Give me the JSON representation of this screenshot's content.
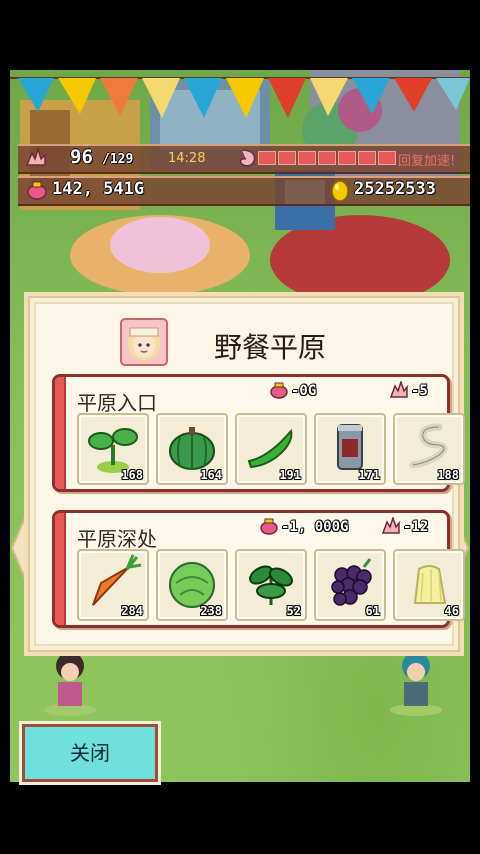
{
  "status": {
    "stamina_current": "96",
    "stamina_max": "/129",
    "time": "14:28",
    "recover_label": "回复加速!",
    "money": "142, 541G",
    "eggs": "25252533"
  },
  "dialog": {
    "title": "野餐平原",
    "sections": [
      {
        "title": "平原入口",
        "money_cost": "-0G",
        "stamina_cost": "-5",
        "items": [
          {
            "icon": "sprout-icon",
            "count": "168"
          },
          {
            "icon": "pumpkin-icon",
            "count": "164"
          },
          {
            "icon": "pea-pod-icon",
            "count": "191"
          },
          {
            "icon": "can-icon",
            "count": "171"
          },
          {
            "icon": "rope-icon",
            "count": "188"
          }
        ]
      },
      {
        "title": "平原深处",
        "money_cost": "-1, 000G",
        "stamina_cost": "-12",
        "items": [
          {
            "icon": "carrot-icon",
            "count": "284"
          },
          {
            "icon": "cabbage-icon",
            "count": "238"
          },
          {
            "icon": "herb-icon",
            "count": "52"
          },
          {
            "icon": "grapes-icon",
            "count": "61"
          },
          {
            "icon": "pudding-icon",
            "count": "46"
          }
        ]
      }
    ]
  },
  "close_label": "关闭",
  "colors": {
    "accent_red": "#e65a5a",
    "close_button": "#6fe0dc",
    "gold": "#f5c800"
  }
}
